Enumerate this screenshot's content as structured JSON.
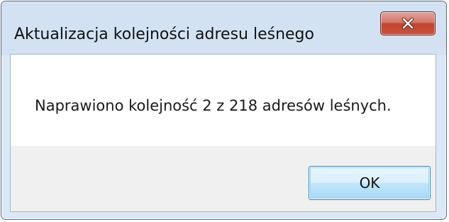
{
  "dialog": {
    "title": "Aktualizacja kolejności adresu leśnego",
    "close_icon": "close-icon",
    "message": "Naprawiono kolejność 2 z 218 adresów leśnych.",
    "ok_label": "OK"
  },
  "colors": {
    "title_bar": "#d3e2f3",
    "close_button": "#c8523b",
    "ok_button_border": "#3c7fb1",
    "footer": "#f0f0f0"
  }
}
